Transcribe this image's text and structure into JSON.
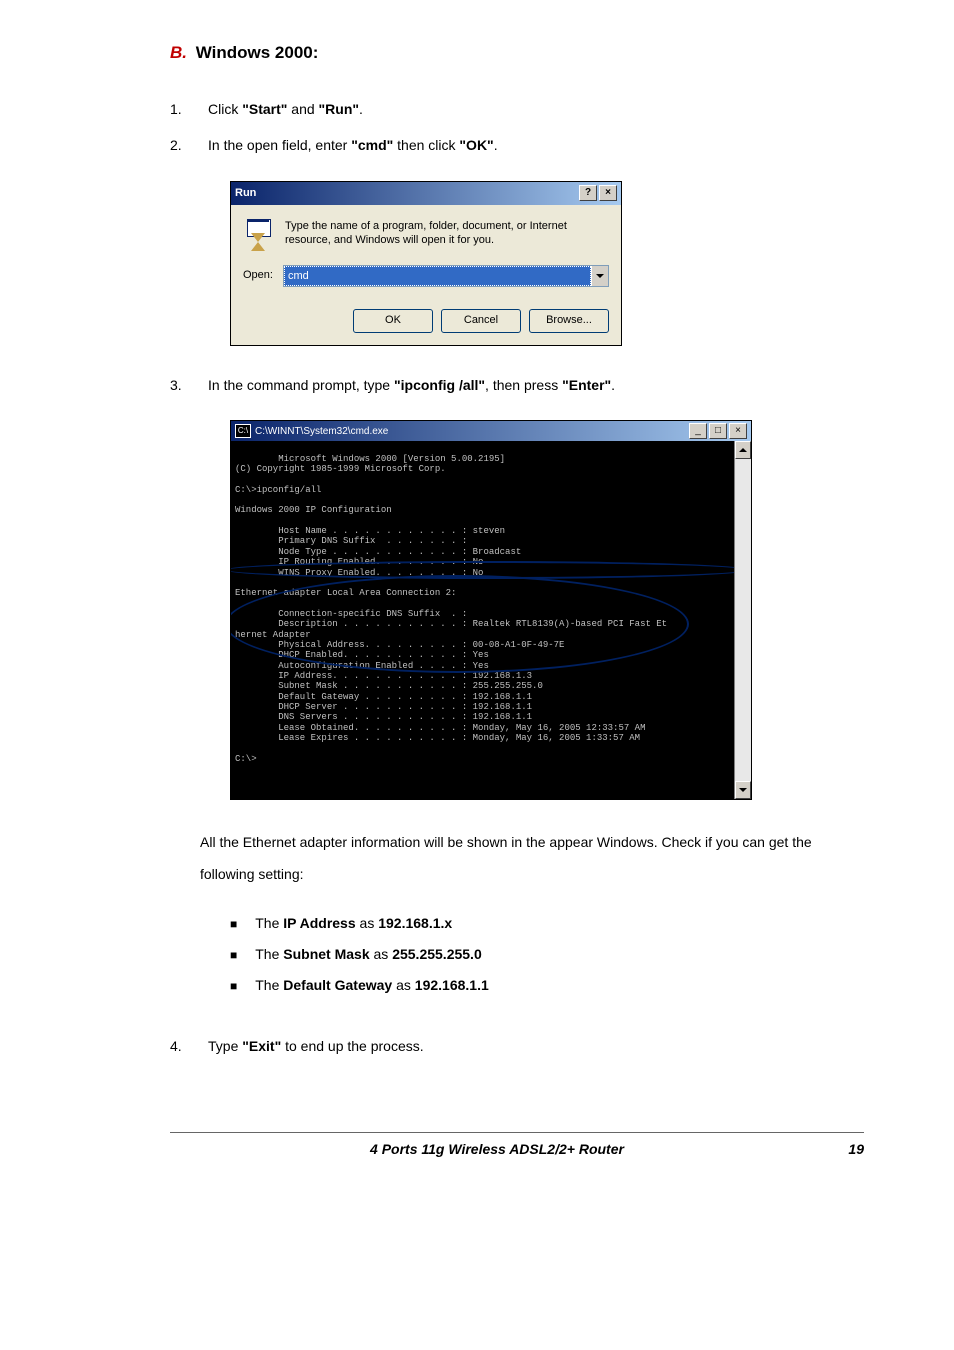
{
  "heading": {
    "prefix": "B.",
    "title": "Windows 2000:"
  },
  "steps12": {
    "1": {
      "num": "1.",
      "t1": "Click ",
      "b1": "\"Start\"",
      "t2": " and ",
      "b2": "\"Run\"",
      "t3": "."
    },
    "2": {
      "num": "2.",
      "t1": "In the open field, enter ",
      "b1": "\"cmd\"",
      "t2": " then click ",
      "b2": "\"OK\"",
      "t3": "."
    }
  },
  "run_dialog": {
    "title": "Run",
    "help": "?",
    "close": "×",
    "desc": "Type the name of a program, folder, document, or Internet resource, and Windows will open it for you.",
    "open_label": "Open:",
    "value": "cmd",
    "buttons": {
      "ok": "OK",
      "cancel": "Cancel",
      "browse": "Browse..."
    }
  },
  "step3": {
    "num": "3.",
    "t1": "In the command prompt, type ",
    "b1": "\"ipconfig /all\"",
    "t2": ", then press ",
    "b2": "\"Enter\"",
    "t3": "."
  },
  "cmd_window": {
    "title": "C:\\WINNT\\System32\\cmd.exe",
    "icon_text": "C:\\",
    "min": "_",
    "max": "□",
    "close": "×",
    "lines": "Microsoft Windows 2000 [Version 5.00.2195]\n(C) Copyright 1985-1999 Microsoft Corp.\n\nC:\\>ipconfig/all\n\nWindows 2000 IP Configuration\n\n        Host Name . . . . . . . . . . . . : steven\n        Primary DNS Suffix  . . . . . . . :\n        Node Type . . . . . . . . . . . . : Broadcast\n        IP Routing Enabled. . . . . . . . : No\n        WINS Proxy Enabled. . . . . . . . : No\n\nEthernet adapter Local Area Connection 2:\n\n        Connection-specific DNS Suffix  . :\n        Description . . . . . . . . . . . : Realtek RTL8139(A)-based PCI Fast Et\nhernet Adapter\n        Physical Address. . . . . . . . . : 00-08-A1-0F-49-7E\n        DHCP Enabled. . . . . . . . . . . : Yes\n        Autoconfiguration Enabled . . . . : Yes\n        IP Address. . . . . . . . . . . . : 192.168.1.3\n        Subnet Mask . . . . . . . . . . . : 255.255.255.0\n        Default Gateway . . . . . . . . . : 192.168.1.1\n        DHCP Server . . . . . . . . . . . : 192.168.1.1\n        DNS Servers . . . . . . . . . . . : 192.168.1.1\n        Lease Obtained. . . . . . . . . . : Monday, May 16, 2005 12:33:57 AM\n        Lease Expires . . . . . . . . . . : Monday, May 16, 2005 1:33:57 AM\n\nC:\\>"
  },
  "after_cmd": "All the Ethernet adapter information will be shown in the appear Windows. Check if you can get the following setting:",
  "checks": {
    "a": {
      "t1": "The ",
      "b1": "IP Address",
      "t2": " as ",
      "b2": "192.168.1.x"
    },
    "b": {
      "t1": "The ",
      "b1": "Subnet Mask",
      "t2": " as ",
      "b2": "255.255.255.0"
    },
    "c": {
      "t1": "The ",
      "b1": "Default Gateway",
      "t2": " as ",
      "b2": "192.168.1.1"
    }
  },
  "step4": {
    "num": "4.",
    "t1": "Type ",
    "b1": "\"Exit\"",
    "t2": " to end up the process."
  },
  "footer": {
    "title": "4 Ports 11g Wireless ADSL2/2+ Router",
    "page": "19"
  }
}
